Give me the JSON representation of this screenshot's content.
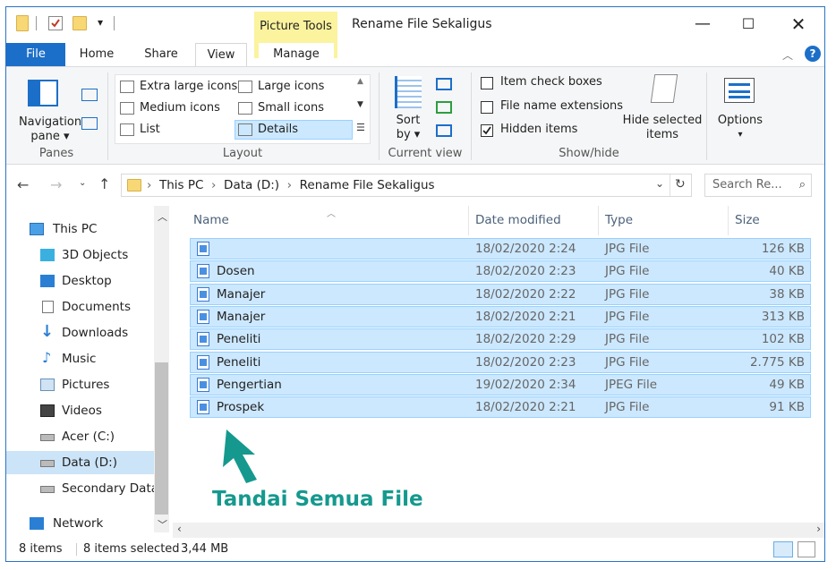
{
  "window": {
    "title": "Rename File Sekaligus",
    "context_tab_group": "Picture Tools"
  },
  "tabs": [
    {
      "label": "File"
    },
    {
      "label": "Home"
    },
    {
      "label": "Share"
    },
    {
      "label": "View"
    },
    {
      "label": "Manage"
    }
  ],
  "ribbon": {
    "panes": {
      "nav_pane": "Navigation",
      "nav_pane2": "pane",
      "group": "Panes"
    },
    "layout": {
      "items": [
        "Extra large icons",
        "Large icons",
        "Medium icons",
        "Small icons",
        "List",
        "Details"
      ],
      "group": "Layout"
    },
    "current_view": {
      "sort": "Sort",
      "sort2": "by",
      "group": "Current view"
    },
    "show_hide": {
      "item_check_boxes": "Item check boxes",
      "file_name_extensions": "File name extensions",
      "hidden_items": "Hidden items",
      "hide_selected": "Hide selected",
      "hide_selected2": "items",
      "group": "Show/hide"
    },
    "options": {
      "label": "Options"
    }
  },
  "address": {
    "crumbs": [
      "This PC",
      "Data  (D:)",
      "Rename File Sekaligus"
    ],
    "search_placeholder": "Search Re..."
  },
  "nav_pane": [
    {
      "label": "This PC",
      "icon": "pc-icon"
    },
    {
      "label": "3D Objects",
      "icon": "cube-icon"
    },
    {
      "label": "Desktop",
      "icon": "desktop-icon"
    },
    {
      "label": "Documents",
      "icon": "document-icon"
    },
    {
      "label": "Downloads",
      "icon": "download-icon"
    },
    {
      "label": "Music",
      "icon": "music-icon"
    },
    {
      "label": "Pictures",
      "icon": "picture-icon"
    },
    {
      "label": "Videos",
      "icon": "video-icon"
    },
    {
      "label": "Acer (C:)",
      "icon": "drive-icon"
    },
    {
      "label": "Data  (D:)",
      "icon": "drive-icon"
    },
    {
      "label": "Secondary Data",
      "icon": "drive-icon"
    },
    {
      "label": "Network",
      "icon": "network-icon"
    }
  ],
  "columns": {
    "name": "Name",
    "date": "Date modified",
    "type": "Type",
    "size": "Size"
  },
  "files": [
    {
      "name": "",
      "date": "18/02/2020 2:24",
      "type": "JPG File",
      "size": "126 KB"
    },
    {
      "name": "Dosen",
      "date": "18/02/2020 2:23",
      "type": "JPG File",
      "size": "40 KB"
    },
    {
      "name": "Manajer",
      "date": "18/02/2020 2:22",
      "type": "JPG File",
      "size": "38 KB"
    },
    {
      "name": "Manajer",
      "date": "18/02/2020 2:21",
      "type": "JPG File",
      "size": "313 KB"
    },
    {
      "name": "Peneliti",
      "date": "18/02/2020 2:29",
      "type": "JPG File",
      "size": "102 KB"
    },
    {
      "name": "Peneliti",
      "date": "18/02/2020 2:23",
      "type": "JPG File",
      "size": "2.775 KB"
    },
    {
      "name": "Pengertian",
      "date": "19/02/2020 2:34",
      "type": "JPEG File",
      "size": "49 KB"
    },
    {
      "name": "Prospek",
      "date": "18/02/2020 2:21",
      "type": "JPG File",
      "size": "91 KB"
    }
  ],
  "status": {
    "count": "8 items",
    "selected": "8 items selected",
    "size": "3,44 MB"
  },
  "annotation": "Tandai Semua File",
  "colors": {
    "accent": "#1c6fc8",
    "selection": "#cce8ff",
    "annotation": "#15998e"
  }
}
